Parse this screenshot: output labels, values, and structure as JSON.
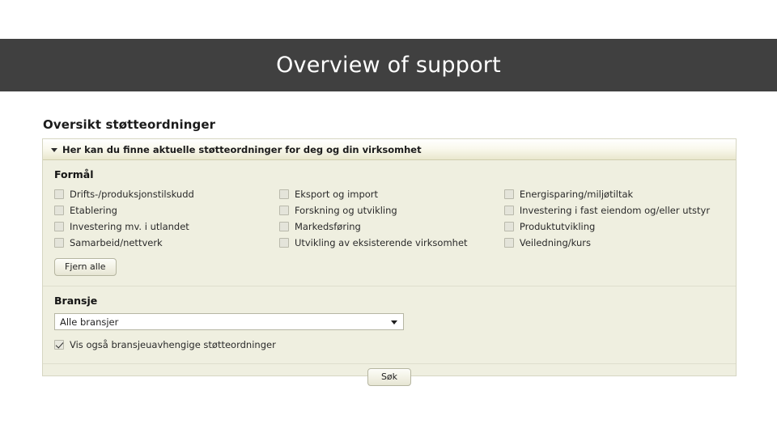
{
  "slide": {
    "title": "Overview of support"
  },
  "screenshot": {
    "page_heading": "Oversikt støtteordninger",
    "panel": {
      "header": {
        "caret": "collapse-caret",
        "text": "Her kan du finne aktuelle støtteordninger for deg og din virksomhet"
      },
      "purpose_section": {
        "title": "Formål",
        "columns": [
          [
            {
              "label": "Drifts-/produksjonstilskudd",
              "checked": false
            },
            {
              "label": "Etablering",
              "checked": false
            },
            {
              "label": "Investering mv. i utlandet",
              "checked": false
            },
            {
              "label": "Samarbeid/nettverk",
              "checked": false
            }
          ],
          [
            {
              "label": "Eksport og import",
              "checked": false
            },
            {
              "label": "Forskning og utvikling",
              "checked": false
            },
            {
              "label": "Markedsføring",
              "checked": false
            },
            {
              "label": "Utvikling av eksisterende virksomhet",
              "checked": false
            }
          ],
          [
            {
              "label": "Energisparing/miljøtiltak",
              "checked": false
            },
            {
              "label": "Investering i fast eiendom og/eller utstyr",
              "checked": false
            },
            {
              "label": "Produktutvikling",
              "checked": false
            },
            {
              "label": "Veiledning/kurs",
              "checked": false
            }
          ]
        ],
        "clear_button": "Fjern alle"
      },
      "industry_section": {
        "title": "Bransje",
        "select": {
          "value": "Alle bransjer",
          "arrow": "chevron-down-icon"
        },
        "independent_checkbox": {
          "label": "Vis også bransjeuavhengige støtteordninger",
          "checked": true
        }
      },
      "submit_button": "Søk"
    }
  },
  "colors": {
    "banner_bg": "#404040",
    "banner_text": "#ffffff",
    "panel_bg": "#efefe0",
    "panel_border": "#d6d6c2",
    "header_gradient_end": "#e9e7cd"
  }
}
